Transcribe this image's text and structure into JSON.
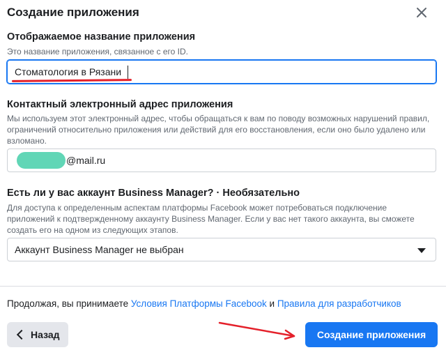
{
  "dialog": {
    "title": "Создание приложения",
    "close_icon": "close-icon"
  },
  "app_name": {
    "label": "Отображаемое название приложения",
    "help": "Это название приложения, связанное с его ID.",
    "value": "Стоматология в Рязани"
  },
  "contact_email": {
    "label": "Контактный электронный адрес приложения",
    "help": "Мы используем этот электронный адрес, чтобы обращаться к вам по поводу возможных нарушений правил, ограничений относительно приложения или действий для его восстановления, если оно было удалено или взломано.",
    "value_suffix": "@mail.ru"
  },
  "business_manager": {
    "label": "Есть ли у вас аккаунт Business Manager? · Необязательно",
    "help": "Для доступа к определенным аспектам платформы Facebook может потребоваться подключение приложений к подтвержденному аккаунту Business Manager. Если у вас нет такого аккаунта, вы сможете создать его на одном из следующих этапов.",
    "selected": "Аккаунт Business Manager не выбран"
  },
  "footer": {
    "terms_prefix": "Продолжая, вы принимаете",
    "terms_link1": "Условия Платформы Facebook",
    "terms_and": "и",
    "terms_link2": "Правила для разработчиков",
    "back_label": "Назад",
    "create_label": "Создание приложения"
  },
  "colors": {
    "accent": "#1877f2",
    "annotation_red": "#e4202a",
    "redaction": "#61d6b6"
  }
}
